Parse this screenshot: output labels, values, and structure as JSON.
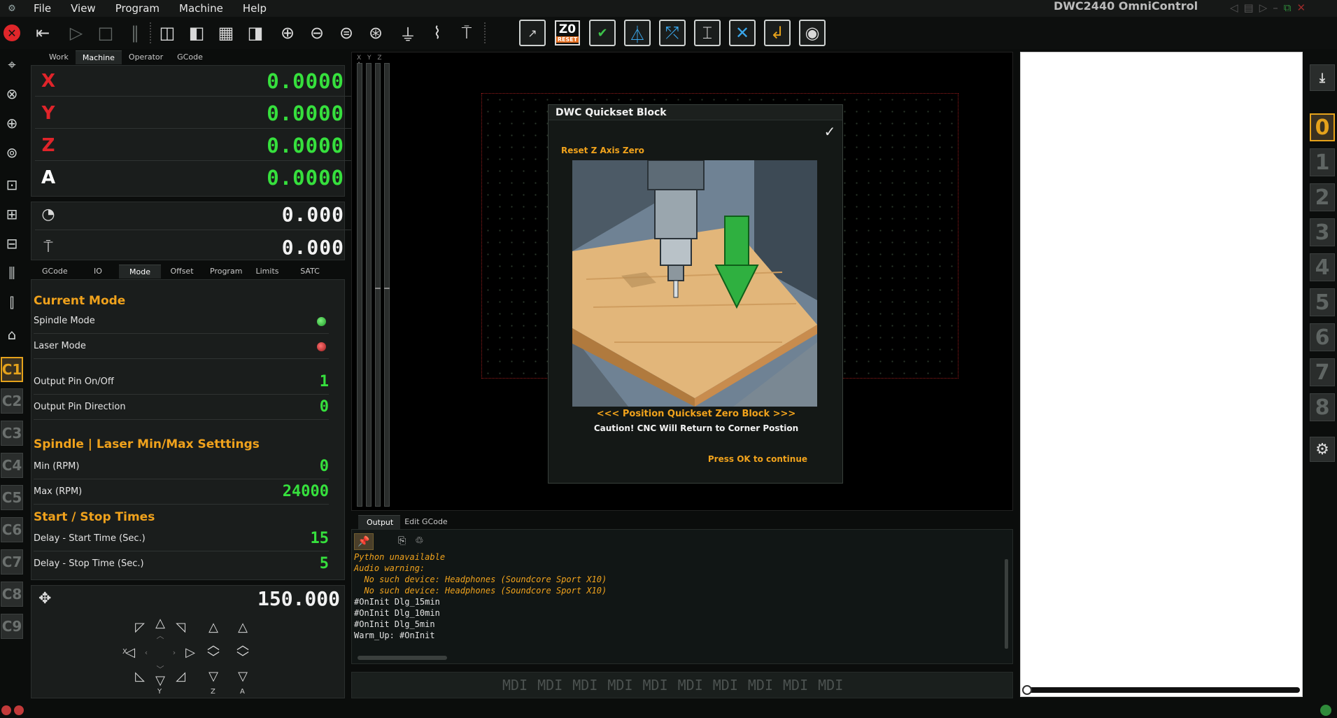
{
  "menubar": {
    "items": [
      "File",
      "View",
      "Program",
      "Machine",
      "Help"
    ],
    "app_title": "DWC2440 OmniControl"
  },
  "dro": {
    "tabs": [
      "Work",
      "Machine",
      "Operator",
      "GCode"
    ],
    "active_tab": "Machine",
    "axes": [
      {
        "letter": "X",
        "value": "0.0000"
      },
      {
        "letter": "Y",
        "value": "0.0000"
      },
      {
        "letter": "Z",
        "value": "0.0000"
      },
      {
        "letter": "A",
        "value": "0.0000"
      }
    ]
  },
  "feed_speed": {
    "feed_value": "0.000",
    "spindle_value": "0.000",
    "feed_icon": "speedometer-icon",
    "spindle_icon": "spindle-icon"
  },
  "settings_tabs": [
    "GCode",
    "IO",
    "Mode",
    "Offset",
    "Program",
    "Limits",
    "SATC"
  ],
  "settings_active_tab": "Mode",
  "mode": {
    "current_mode_title": "Current Mode",
    "spindle_mode": "Spindle Mode",
    "laser_mode": "Laser Mode",
    "output_pin_onoff": "Output Pin On/Off",
    "output_pin_onoff_value": "1",
    "output_pin_dir": "Output Pin Direction",
    "output_pin_dir_value": "0",
    "minmax_title": "Spindle | Laser Min/Max Setttings",
    "min_label": "Min (RPM)",
    "min_value": "0",
    "max_label": "Max (RPM)",
    "max_value": "24000",
    "startstop_title": "Start / Stop Times",
    "start_label": "Delay - Start Time (Sec.)",
    "start_value": "15",
    "stop_label": "Delay - Stop Time (Sec.)",
    "stop_value": "5"
  },
  "jog": {
    "value": "150.000",
    "label_x": "X",
    "label_y": "Y",
    "label_z": "Z",
    "label_a": "A"
  },
  "left_rail": {
    "c_buttons": [
      "C1",
      "C2",
      "C3",
      "C4",
      "C5",
      "C6",
      "C7",
      "C8",
      "C9"
    ],
    "active": "C1"
  },
  "axis_bars_label": "X Y Z A",
  "dialog": {
    "title": "DWC Quickset Block",
    "ok_icon": "✓",
    "subtitle": "Reset Z Axis Zero",
    "nav_text": "<<< Position Quickset Zero Block >>>",
    "caution_text": "Caution! CNC Will Return to Corner Postion",
    "press_text": "Press OK to continue"
  },
  "output": {
    "tabs": [
      "Output",
      "Edit GCode"
    ],
    "active_tab": "Output",
    "lines": [
      {
        "text": "Python unavailable",
        "kind": "warn"
      },
      {
        "text": "Audio warning:",
        "kind": "warn"
      },
      {
        "text": "  No such device: Headphones (Soundcore Sport X10)",
        "kind": "warn"
      },
      {
        "text": "  No such device: Headphones (Soundcore Sport X10)",
        "kind": "warn"
      },
      {
        "text": "#OnInit Dlg_15min",
        "kind": "norm"
      },
      {
        "text": "#OnInit Dlg_10min",
        "kind": "norm"
      },
      {
        "text": "#OnInit Dlg_5min",
        "kind": "norm"
      },
      {
        "text": "Warm_Up: #OnInit",
        "kind": "norm"
      }
    ]
  },
  "mdi": {
    "buttons": [
      "MDI",
      "MDI",
      "MDI",
      "MDI",
      "MDI",
      "MDI",
      "MDI",
      "MDI",
      "MDI",
      "MDI"
    ]
  },
  "right_rail": {
    "numbers": [
      "0",
      "1",
      "2",
      "3",
      "4",
      "5",
      "6",
      "7",
      "8"
    ],
    "active": "0"
  },
  "toolbar": {
    "z0_label": "Z0",
    "z0_reset": "RESET"
  },
  "colors": {
    "accent_orange": "#f0a21c",
    "dro_green": "#36e03d",
    "axis_red": "#e0242a",
    "stop_red": "#e0262a"
  }
}
